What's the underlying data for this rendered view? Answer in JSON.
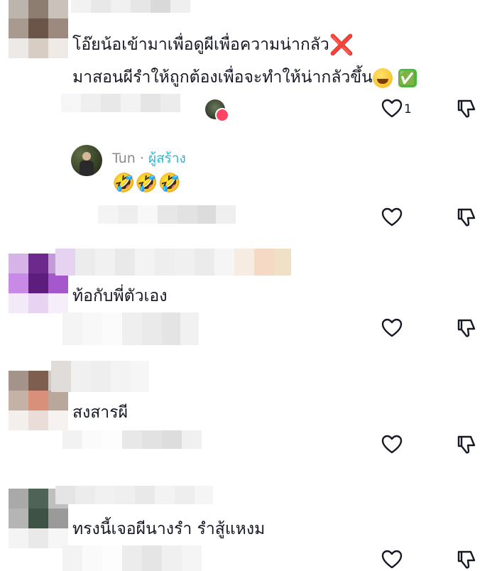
{
  "comments": [
    {
      "line1": "โอ๊ยน้อเข้ามาเพื่อดูผีเพื่อความน่ากลัว",
      "line1_emoji": "❌",
      "line2": "มาสอนผีรำให้ถูกต้องเพื่อจะทำให้น่ากลัวขึ้น",
      "line2_emoji": "✅",
      "like_count": "1"
    },
    {
      "username": "Tun",
      "separator": "·",
      "creator_label": "ผู้สร้าง",
      "text": "🤣🤣🤣"
    },
    {
      "text": "ท้อกับพี่ตัวเอง"
    },
    {
      "text": "สงสารผี"
    },
    {
      "text": "ทรงนี้เจอผีนางรำ รำสู้แหงม"
    }
  ],
  "colors": {
    "creator_accent": "#28b8d6",
    "icon": "#161823"
  }
}
